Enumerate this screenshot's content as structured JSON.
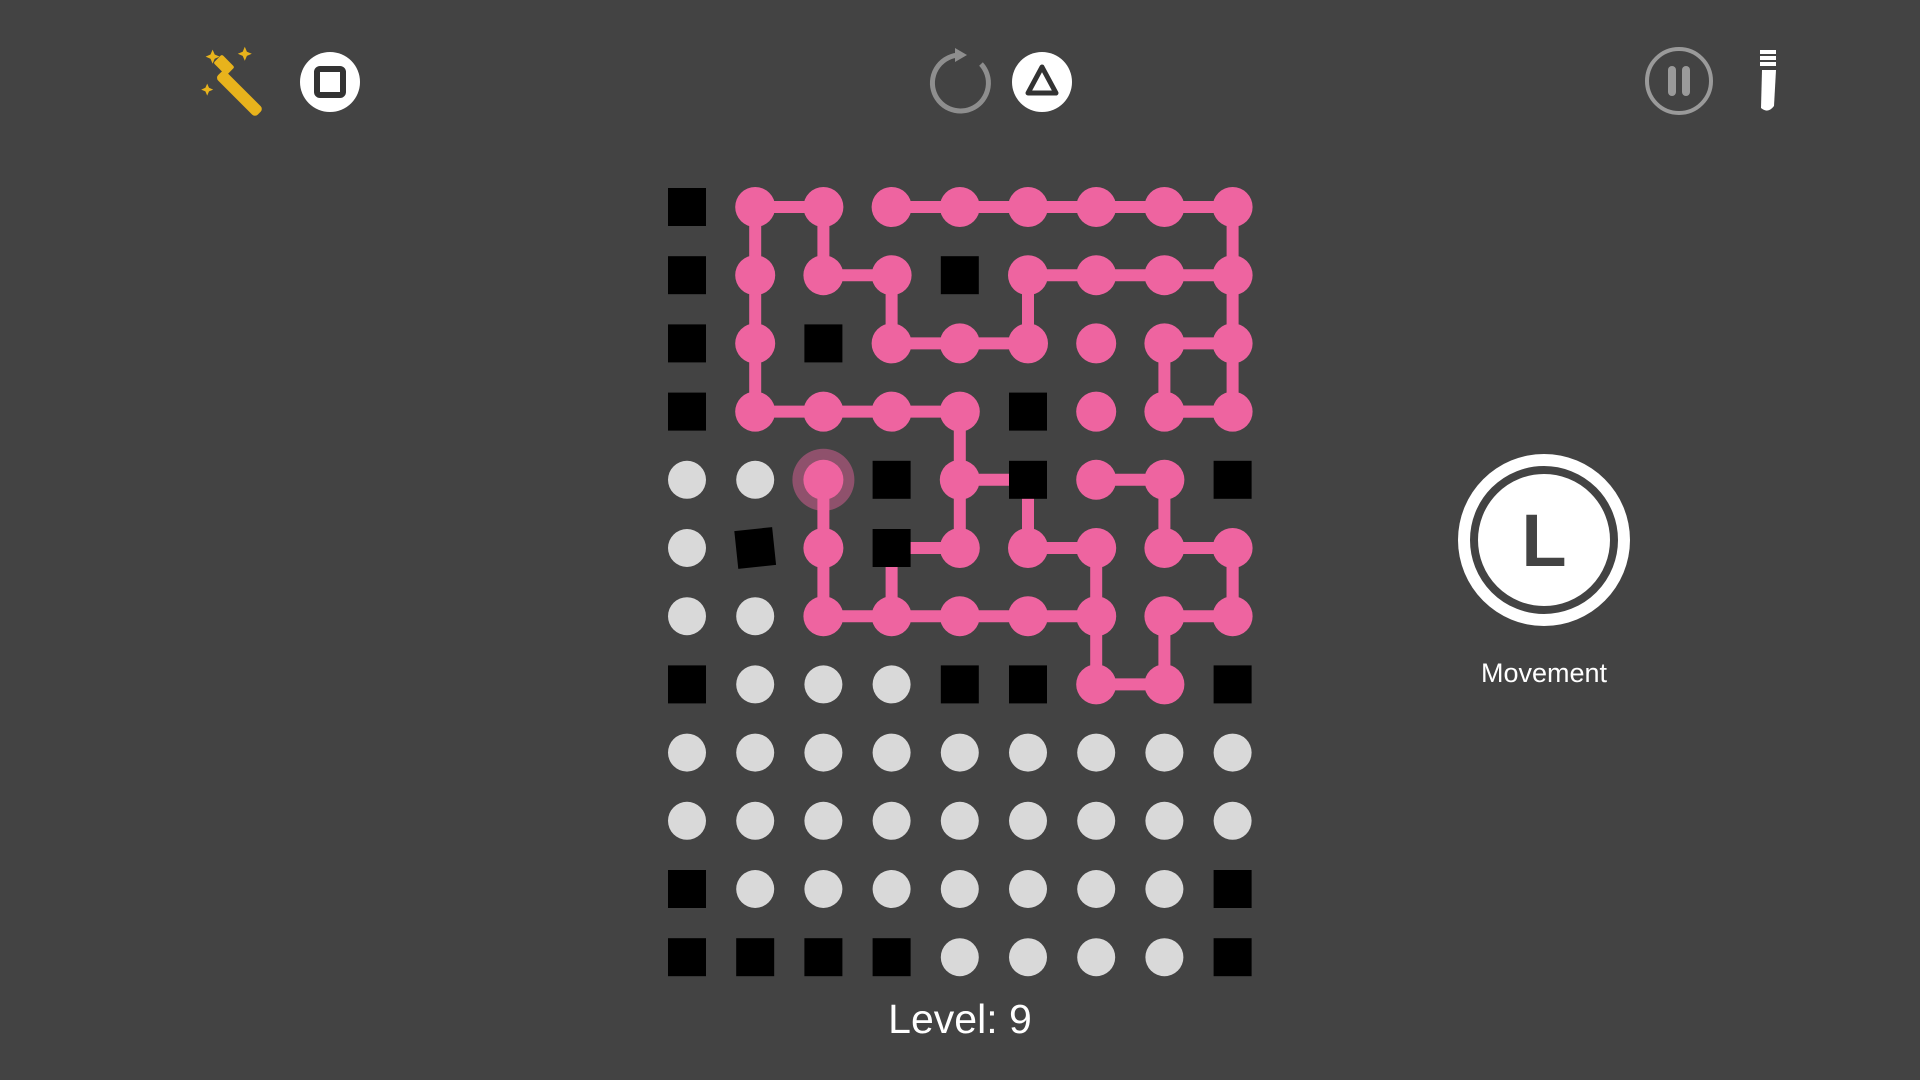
{
  "hud": {
    "hint_icon": "magic-wand-icon",
    "stop_icon": "square-stop-icon",
    "restart_icon": "restart-arrow-icon",
    "triangle_icon": "triangle-icon",
    "pause_icon": "pause-icon",
    "battery_icon": "battery-vertical-icon"
  },
  "level": {
    "label": "Level:",
    "number": "9"
  },
  "controls": {
    "movement_key": "L",
    "movement_label": "Movement"
  },
  "colors": {
    "background": "#434343",
    "path": "#ee64a0",
    "dot_empty": "#d9d9d9",
    "block": "#000000",
    "hint_accent": "#e8b31c"
  },
  "grid": {
    "columns": 9,
    "rows": 12,
    "cursor": [
      4,
      2
    ],
    "cells": [
      "BPPPPPPPP",
      "BPPPBPPPP",
      "BPBPPPPPP",
      "BPPPPBPPP",
      "EEPBPBPPB",
      "EBPBPPPPP",
      "EEPPPPPPP",
      "BEEEBBPPB",
      "EEEEEEEEE",
      "EEEEEEEEE",
      "BEEEEEEEB",
      "BBBBEEEEB"
    ],
    "path": [
      [
        [
          0,
          1
        ],
        [
          0,
          2
        ],
        [
          1,
          2
        ],
        [
          1,
          3
        ]
      ],
      [
        [
          0,
          1
        ],
        [
          1,
          1
        ],
        [
          2,
          1
        ],
        [
          3,
          1
        ],
        [
          3,
          2
        ],
        [
          3,
          3
        ],
        [
          3,
          4
        ],
        [
          4,
          4
        ],
        [
          5,
          4
        ],
        [
          5,
          3
        ],
        [
          6,
          3
        ],
        [
          6,
          4
        ],
        [
          6,
          5
        ],
        [
          6,
          6
        ],
        [
          5,
          6
        ],
        [
          5,
          5
        ],
        [
          4,
          5
        ],
        [
          4,
          4
        ]
      ],
      [
        [
          1,
          3
        ],
        [
          2,
          3
        ]
      ],
      [
        [
          4,
          2
        ],
        [
          5,
          2
        ],
        [
          6,
          2
        ],
        [
          6,
          3
        ]
      ],
      [
        [
          2,
          3
        ],
        [
          2,
          4
        ],
        [
          2,
          5
        ],
        [
          1,
          5
        ],
        [
          1,
          6
        ]
      ],
      [
        [
          0,
          3
        ],
        [
          0,
          4
        ],
        [
          0,
          5
        ],
        [
          0,
          6
        ],
        [
          0,
          7
        ],
        [
          0,
          8
        ],
        [
          1,
          8
        ],
        [
          1,
          7
        ],
        [
          1,
          6
        ]
      ],
      [
        [
          1,
          8
        ],
        [
          2,
          8
        ],
        [
          2,
          7
        ],
        [
          3,
          7
        ],
        [
          3,
          8
        ],
        [
          2,
          8
        ]
      ],
      [
        [
          4,
          6
        ],
        [
          4,
          7
        ],
        [
          5,
          7
        ],
        [
          5,
          8
        ],
        [
          6,
          8
        ],
        [
          6,
          7
        ],
        [
          7,
          7
        ],
        [
          7,
          6
        ],
        [
          6,
          6
        ]
      ],
      [
        [
          6,
          8
        ],
        [
          5,
          8
        ]
      ],
      [
        [
          3,
          8
        ],
        [
          3,
          7
        ]
      ]
    ]
  }
}
